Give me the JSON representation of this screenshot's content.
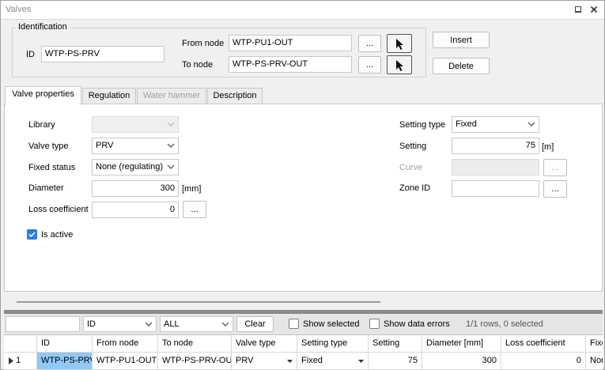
{
  "window": {
    "title": "Valves",
    "pin_icon": "pin-icon",
    "close_icon": "close-icon"
  },
  "identification": {
    "group_label": "Identification",
    "id_label": "ID",
    "id_value": "WTP-PS-PRV",
    "from_node_label": "From node",
    "from_node_value": "WTP-PU1-OUT",
    "to_node_label": "To node",
    "to_node_value": "WTP-PS-PRV-OUT",
    "browse_label": "...",
    "insert_label": "Insert",
    "delete_label": "Delete"
  },
  "tabs": [
    {
      "label": "Valve properties",
      "active": true
    },
    {
      "label": "Regulation"
    },
    {
      "label": "Water hammer",
      "disabled": true
    },
    {
      "label": "Description"
    }
  ],
  "properties": {
    "library_label": "Library",
    "library_value": "",
    "valve_type_label": "Valve type",
    "valve_type_value": "PRV",
    "fixed_status_label": "Fixed status",
    "fixed_status_value": "None (regulating)",
    "diameter_label": "Diameter",
    "diameter_value": "300",
    "diameter_unit": "[mm]",
    "loss_coefficient_label": "Loss coefficient",
    "loss_coefficient_value": "0",
    "is_active_label": "Is active",
    "is_active_checked": true,
    "setting_type_label": "Setting type",
    "setting_type_value": "Fixed",
    "setting_label": "Setting",
    "setting_value": "75",
    "setting_unit": "[m]",
    "curve_label": "Curve",
    "curve_value": "",
    "zone_id_label": "Zone ID",
    "zone_id_value": "",
    "browse_label": "..."
  },
  "grid_toolbar": {
    "filter_value": "",
    "column_select_value": "ID",
    "scope_select_value": "ALL",
    "clear_label": "Clear",
    "show_selected_label": "Show selected",
    "show_data_errors_label": "Show data errors",
    "status_text": "1/1 rows, 0 selected"
  },
  "grid": {
    "columns": [
      "ID",
      "From node",
      "To node",
      "Valve type",
      "Setting type",
      "Setting",
      "Diameter [mm]",
      "Loss coefficient",
      "Fixe"
    ],
    "rows": [
      {
        "index": "1",
        "cells": [
          "WTP-PS-PRV",
          "WTP-PU1-OUT",
          "WTP-PS-PRV-OUT",
          "PRV",
          "Fixed",
          "75",
          "300",
          "0",
          "Non"
        ]
      }
    ]
  }
}
